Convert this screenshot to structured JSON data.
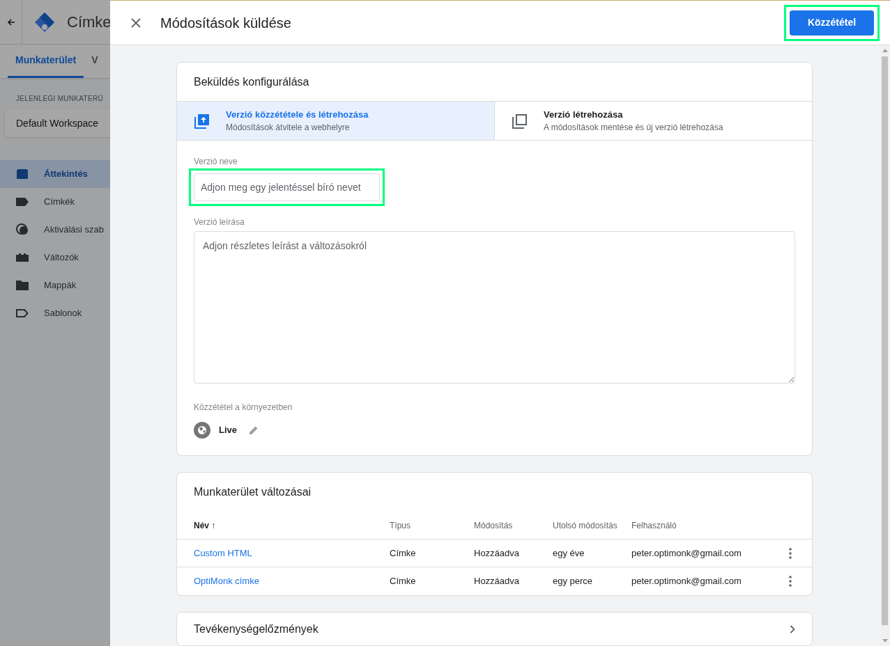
{
  "app": {
    "title": "Címke",
    "tabs": [
      {
        "label": "Munkaterület",
        "selected": true
      },
      {
        "label": "V",
        "selected": false
      }
    ],
    "workspace_label": "JELENLEGI MUNKATERÜ",
    "workspace": "Default Workspace",
    "nav": [
      {
        "label": "Áttekintés",
        "kind": "overview",
        "selected": true
      },
      {
        "label": "Címkék",
        "kind": "tag",
        "selected": false
      },
      {
        "label": "Aktiválási szab",
        "kind": "trigger",
        "selected": false
      },
      {
        "label": "Változók",
        "kind": "variable",
        "selected": false
      },
      {
        "label": "Mappák",
        "kind": "folder",
        "selected": false
      },
      {
        "label": "Sablonok",
        "kind": "template",
        "selected": false
      }
    ]
  },
  "dialog": {
    "title": "Módosítások küldése",
    "publish_button": {
      "label": "Közzététel",
      "highlighted": true
    },
    "config": {
      "title": "Beküldés konfigurálása",
      "options": [
        {
          "title": "Verzió közzététele és létrehozása",
          "subtitle": "Módosítások átvitele a webhelyre",
          "selected": true
        },
        {
          "title": "Verzió létrehozása",
          "subtitle": "A módosítások mentése és új verzió létrehozása",
          "selected": false
        }
      ],
      "version_name": {
        "label": "Verzió neve",
        "placeholder": "Adjon meg egy jelentéssel bíró nevet",
        "highlighted": true
      },
      "version_description": {
        "label": "Verzió leírása",
        "placeholder": "Adjon részletes leírást a változásokról"
      },
      "environment": {
        "label": "Közzététel a környezetben",
        "name": "Live"
      }
    },
    "changes": {
      "title": "Munkaterület változásai",
      "columns": [
        "Név ↑",
        "Típus",
        "Módosítás",
        "Utolsó módosítás",
        "Felhasználó"
      ],
      "rows": [
        [
          "Custom HTML",
          "Címke",
          "Hozzáadva",
          "egy éve",
          "peter.optimonk@gmail.com"
        ],
        [
          "OptiMonk címke",
          "Címke",
          "Hozzáadva",
          "egy perce",
          "peter.optimonk@gmail.com"
        ]
      ]
    },
    "history": {
      "title": "Tevékenységelőzmények"
    }
  }
}
